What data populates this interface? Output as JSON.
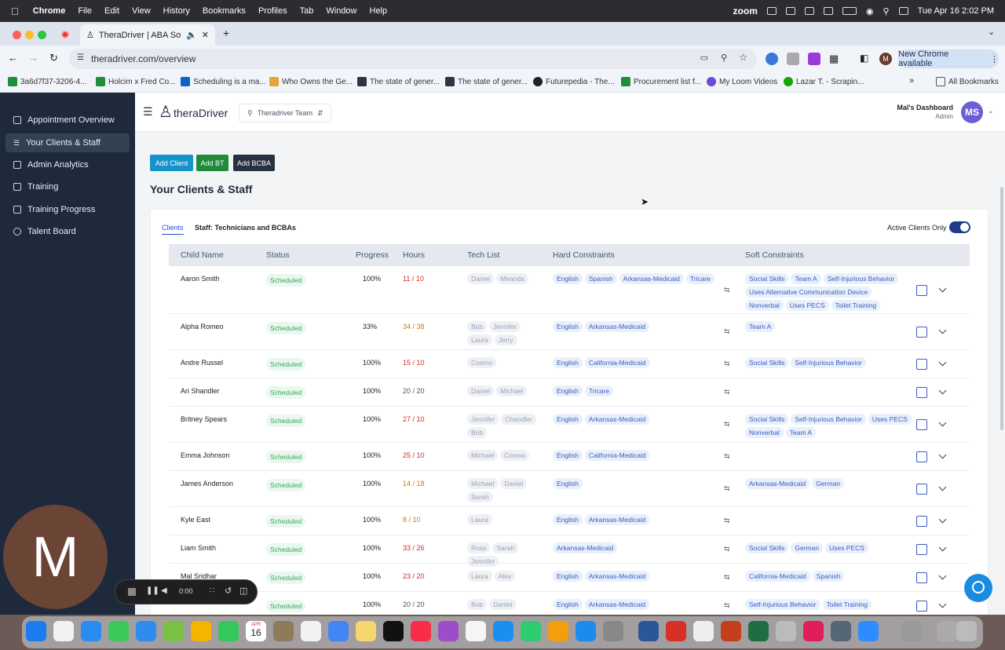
{
  "menubar": {
    "app": "Chrome",
    "items": [
      "File",
      "Edit",
      "View",
      "History",
      "Bookmarks",
      "Profiles",
      "Tab",
      "Window",
      "Help"
    ],
    "zoom_label": "zoom",
    "datetime": "Tue Apr 16  2:02 PM"
  },
  "browser": {
    "tab_title": "TheraDriver | ABA Softwa",
    "url": "theradriver.com/overview",
    "new_chrome": "New Chrome available",
    "profile_initial": "M",
    "bookmarks": [
      "3a6d7f37-3206-4...",
      "Holcim x Fred Co...",
      "Scheduling is a ma...",
      "Who Owns the Ge...",
      "The state of gener...",
      "The state of gener...",
      "Futurepedia - The...",
      "Procurement list f...",
      "My Loom Videos",
      "Lazar T. - Scrapin..."
    ],
    "all_bookmarks": "All Bookmarks"
  },
  "sidebar": {
    "items": [
      {
        "label": "Appointment Overview"
      },
      {
        "label": "Your Clients & Staff"
      },
      {
        "label": "Admin Analytics"
      },
      {
        "label": "Training"
      },
      {
        "label": "Training Progress"
      },
      {
        "label": "Talent Board"
      }
    ]
  },
  "topbar": {
    "brand": "theraDriver",
    "team_select": "Theradriver Team",
    "dashboard": "Mal's Dashboard",
    "role": "Admin",
    "initials": "MS"
  },
  "actions": {
    "add_client": "Add Client",
    "add_bt": "Add BT",
    "add_bcba": "Add BCBA"
  },
  "page_title": "Your Clients & Staff",
  "tabs": {
    "clients": "Clients",
    "staff": "Staff: Technicians and BCBAs"
  },
  "active_toggle_label": "Active Clients Only",
  "table": {
    "headers": [
      "Child Name",
      "Status",
      "Progress",
      "Hours",
      "Tech List",
      "Hard Constraints",
      "Soft Constraints"
    ],
    "rows": [
      {
        "name": "Aaron Smith",
        "status": "Scheduled",
        "progress": "100%",
        "hours": "11 / 10",
        "hcolor": "#dc2626",
        "tech": [
          "Daniel",
          "Miranda"
        ],
        "hard": [
          "English",
          "Spanish",
          "Arkansas-Medicaid",
          "Tricare"
        ],
        "soft": [
          "Social Skills",
          "Team A",
          "Self-Injurious Behavior",
          "Uses Alternative Communication Device",
          "Nonverbal",
          "Uses PECS",
          "Toilet Training"
        ]
      },
      {
        "name": "Alpha Romeo",
        "status": "Scheduled",
        "progress": "33%",
        "hours": "34 / 38",
        "hcolor": "#d97706",
        "tech": [
          "Bob",
          "Jennifer",
          "Laura",
          "Jerry"
        ],
        "hard": [
          "English",
          "Arkansas-Medicaid"
        ],
        "soft": [
          "Team A"
        ]
      },
      {
        "name": "Andre Russel",
        "status": "Scheduled",
        "progress": "100%",
        "hours": "15 / 10",
        "hcolor": "#dc2626",
        "tech": [
          "Cosmo"
        ],
        "hard": [
          "English",
          "California-Medicaid"
        ],
        "soft": [
          "Social Skills",
          "Self-Injurious Behavior"
        ]
      },
      {
        "name": "Ari Shandler",
        "status": "Scheduled",
        "progress": "100%",
        "hours": "20 / 20",
        "hcolor": "#475569",
        "tech": [
          "Daniel",
          "Michael"
        ],
        "hard": [
          "English",
          "Tricare"
        ],
        "soft": []
      },
      {
        "name": "Britney Spears",
        "status": "Scheduled",
        "progress": "100%",
        "hours": "27 / 10",
        "hcolor": "#dc2626",
        "tech": [
          "Jennifer",
          "Chandler",
          "Bob"
        ],
        "hard": [
          "English",
          "Arkansas-Medicaid"
        ],
        "soft": [
          "Social Skills",
          "Self-Injurious Behavior",
          "Uses PECS",
          "Nonverbal",
          "Team A"
        ]
      },
      {
        "name": "Emma Johnson",
        "status": "Scheduled",
        "progress": "100%",
        "hours": "25 / 10",
        "hcolor": "#dc2626",
        "tech": [
          "Michael",
          "Cosmo"
        ],
        "hard": [
          "English",
          "California-Medicaid"
        ],
        "soft": []
      },
      {
        "name": "James Anderson",
        "status": "Scheduled",
        "progress": "100%",
        "hours": "14 / 18",
        "hcolor": "#d97706",
        "tech": [
          "Michael",
          "Daniel",
          "Sarah"
        ],
        "hard": [
          "English"
        ],
        "soft": [
          "Arkansas-Medicaid",
          "German"
        ]
      },
      {
        "name": "Kyle East",
        "status": "Scheduled",
        "progress": "100%",
        "hours": "8 / 10",
        "hcolor": "#d97706",
        "tech": [
          "Laura"
        ],
        "hard": [
          "English",
          "Arkansas-Medicaid"
        ],
        "soft": []
      },
      {
        "name": "Liam Smith",
        "status": "Scheduled",
        "progress": "100%",
        "hours": "33 / 26",
        "hcolor": "#dc2626",
        "tech": [
          "Ross",
          "Sarah",
          "Jennifer"
        ],
        "hard": [
          "Arkansas-Medicaid"
        ],
        "soft": [
          "Social Skills",
          "German",
          "Uses PECS"
        ]
      },
      {
        "name": "Mal Sridhar",
        "status": "Scheduled",
        "progress": "100%",
        "hours": "23 / 20",
        "hcolor": "#dc2626",
        "tech": [
          "Laura",
          "Alex"
        ],
        "hard": [
          "English",
          "Arkansas-Medicaid"
        ],
        "soft": [
          "California-Medicaid",
          "Spanish"
        ]
      },
      {
        "name": "",
        "status": "Scheduled",
        "progress": "100%",
        "hours": "20 / 20",
        "hcolor": "#475569",
        "tech": [
          "Bob",
          "Daniel"
        ],
        "hard": [
          "English",
          "Arkansas-Medicaid"
        ],
        "soft": [
          "Self-Injurious Behavior",
          "Toilet Training"
        ]
      }
    ]
  },
  "recorder": {
    "time": "0:00"
  },
  "webcam_initial": "M",
  "dock": {
    "calendar_month": "APR",
    "calendar_day": "16"
  }
}
